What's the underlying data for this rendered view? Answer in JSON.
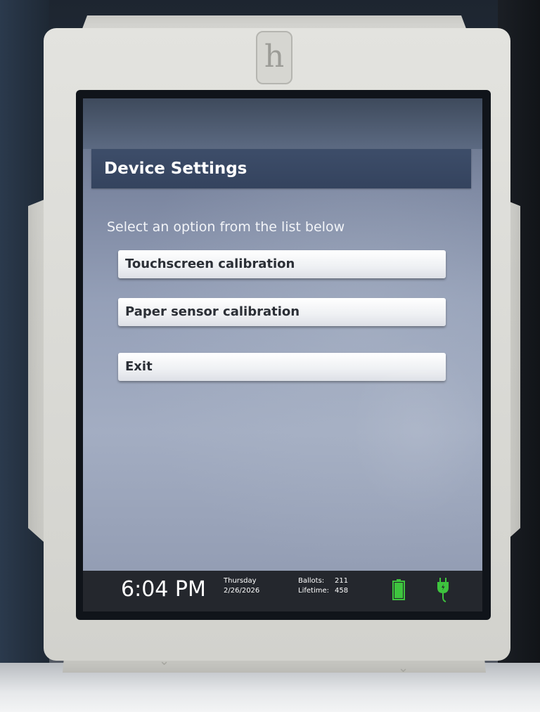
{
  "device": {
    "logo_glyph": "h"
  },
  "screen": {
    "title": "Device Settings",
    "instruction": "Select an option from the list below",
    "options": [
      {
        "label": "Touchscreen calibration"
      },
      {
        "label": "Paper sensor calibration"
      },
      {
        "label": "Exit"
      }
    ]
  },
  "status_bar": {
    "time": "6:04 PM",
    "day": "Thursday",
    "date": "2/26/2026",
    "ballots_label": "Ballots:",
    "ballots_value": "211",
    "lifetime_label": "Lifetime:",
    "lifetime_value": "458",
    "battery_icon": "battery-full-icon",
    "power_icon": "ac-power-plug-icon",
    "status_color": "#3ec43e"
  }
}
